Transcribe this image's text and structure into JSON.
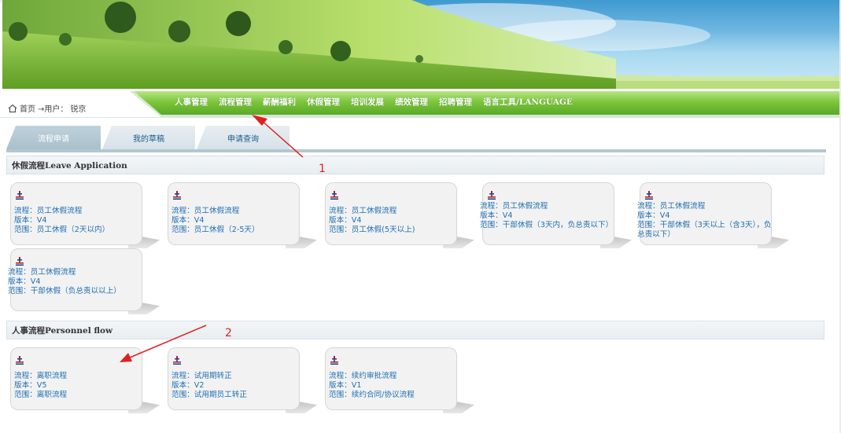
{
  "breadcrumb": {
    "home": "首页",
    "sep": "→用户：",
    "user": "锐京"
  },
  "menu": [
    "人事管理",
    "流程管理",
    "薪酬福利",
    "休假管理",
    "培训发展",
    "绩效管理",
    "招聘管理",
    "语言工具/LANGUAGE"
  ],
  "tabs": [
    "流程申请",
    "我的草稿",
    "申请查询"
  ],
  "sections": [
    {
      "title": "休假流程Leave Application",
      "cards": [
        {
          "flow": "流程：员工休假流程",
          "version": "版本：V4",
          "scope": "范围：员工休假（2天以内）"
        },
        {
          "flow": "流程：员工休假流程",
          "version": "版本：V4",
          "scope": "范围：员工休假（2-5天）"
        },
        {
          "flow": "流程：员工休假流程",
          "version": "版本：V4",
          "scope": "范围：员工休假(5天以上)"
        },
        {
          "flow": "流程：员工休假流程",
          "version": "版本：V4",
          "scope": "范围：干部休假（3天内，负总责以下）"
        },
        {
          "flow": "流程：员工休假流程",
          "version": "版本：V4",
          "scope": "范围：干部休假（3天以上（含3天），负总责以下）"
        },
        {
          "flow": "流程：员工休假流程",
          "version": "版本：V4",
          "scope": "范围：干部休假（负总责以以上）"
        }
      ]
    },
    {
      "title": "人事流程Personnel flow",
      "cards": [
        {
          "flow": "流程：离职流程",
          "version": "版本：V5",
          "scope": "范围：离职流程"
        },
        {
          "flow": "流程：试用期转正",
          "version": "版本：V2",
          "scope": "范围：试用期员工转正"
        },
        {
          "flow": "流程：续约审批流程",
          "version": "版本：V1",
          "scope": "范围：续约合同/协议流程"
        }
      ]
    }
  ],
  "annotations": [
    "1",
    "2"
  ],
  "colors": {
    "link": "#1f6fb3",
    "menu_green": "#6cbb33",
    "annotation": "#e02020"
  }
}
